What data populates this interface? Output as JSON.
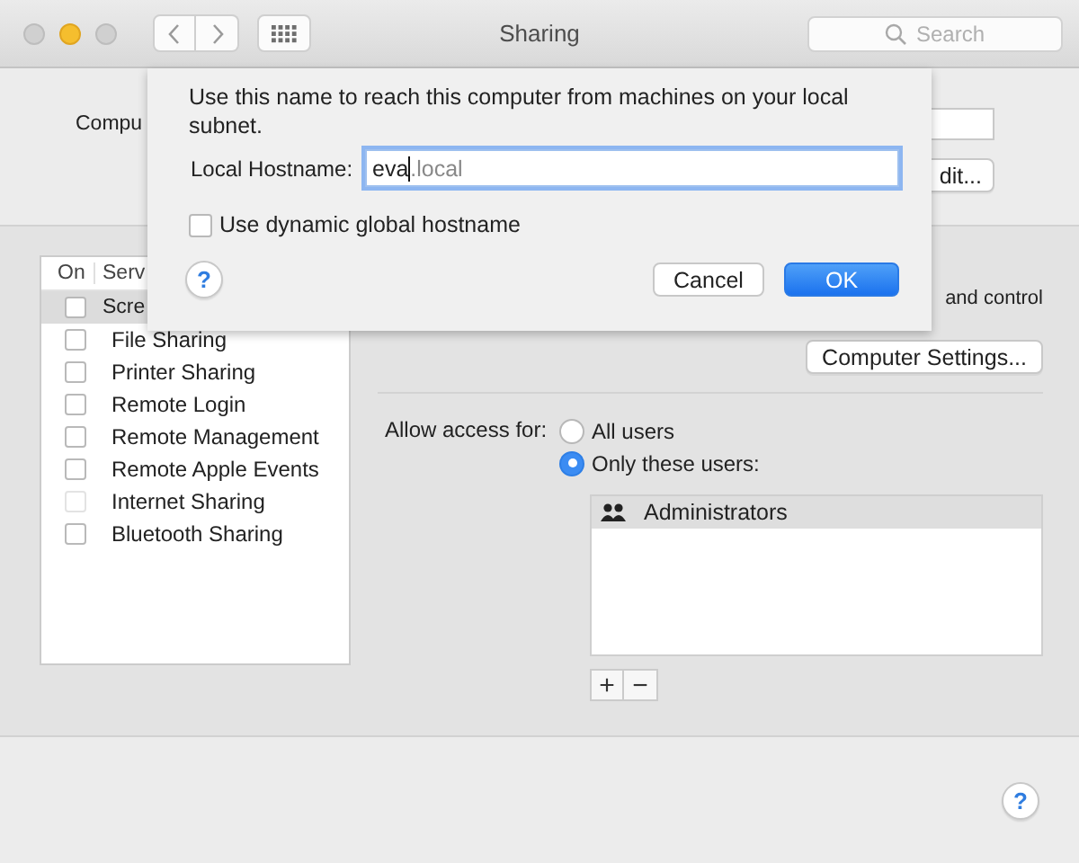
{
  "window": {
    "title": "Sharing",
    "search": {
      "placeholder": "Search"
    }
  },
  "computer_name": {
    "label": "Compu",
    "edit_button": "dit..."
  },
  "services": {
    "columns": [
      "On",
      "Serv"
    ],
    "items": [
      {
        "name": "Scre",
        "checked": false,
        "selected": true,
        "disabled": false
      },
      {
        "name": "File Sharing",
        "checked": false,
        "selected": false,
        "disabled": false
      },
      {
        "name": "Printer Sharing",
        "checked": false,
        "selected": false,
        "disabled": false
      },
      {
        "name": "Remote Login",
        "checked": false,
        "selected": false,
        "disabled": false
      },
      {
        "name": "Remote Management",
        "checked": false,
        "selected": false,
        "disabled": false
      },
      {
        "name": "Remote Apple Events",
        "checked": false,
        "selected": false,
        "disabled": false
      },
      {
        "name": "Internet Sharing",
        "checked": false,
        "selected": false,
        "disabled": true
      },
      {
        "name": "Bluetooth Sharing",
        "checked": false,
        "selected": false,
        "disabled": false
      }
    ]
  },
  "details": {
    "description": "and control",
    "settings_button": "Computer Settings...",
    "access_label": "Allow access for:",
    "access_options": [
      {
        "label": "All users",
        "selected": false
      },
      {
        "label": "Only these users:",
        "selected": true
      }
    ],
    "users": [
      {
        "name": "Administrators"
      }
    ],
    "add_button": "+",
    "remove_button": "−"
  },
  "sheet": {
    "message": "Use this name to reach this computer from machines on your local subnet.",
    "hostname_label": "Local Hostname:",
    "hostname_value": "eva",
    "hostname_suffix": ".local",
    "dynamic_checkbox": {
      "label": "Use dynamic global hostname",
      "checked": false
    },
    "help": "?",
    "buttons": [
      {
        "label": "Cancel",
        "kind": "secondary"
      },
      {
        "label": "OK",
        "kind": "default"
      }
    ]
  },
  "help": "?"
}
